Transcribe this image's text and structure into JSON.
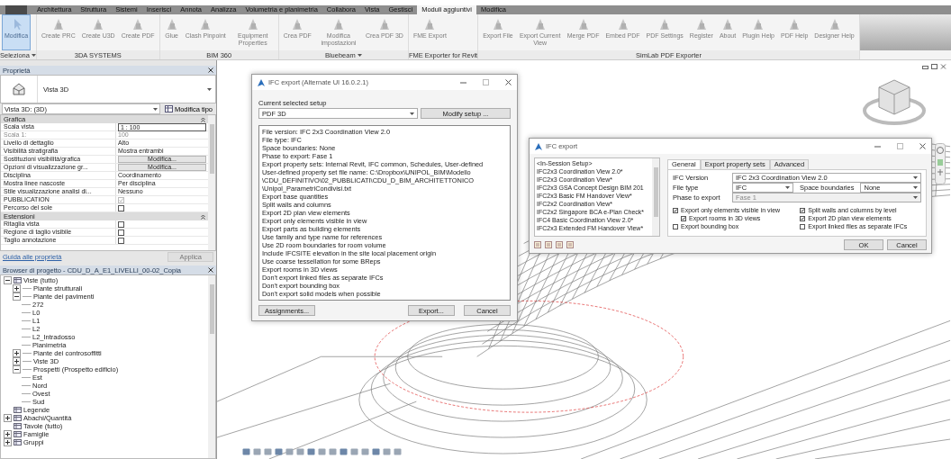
{
  "ribbon": {
    "tabs": [
      {
        "label": "Architettura",
        "selected": false
      },
      {
        "label": "Struttura",
        "selected": false
      },
      {
        "label": "Sistemi",
        "selected": false
      },
      {
        "label": "Inserisci",
        "selected": false
      },
      {
        "label": "Annota",
        "selected": false
      },
      {
        "label": "Analizza",
        "selected": false
      },
      {
        "label": "Volumetria e planimetria",
        "selected": false
      },
      {
        "label": "Collabora",
        "selected": false
      },
      {
        "label": "Vista",
        "selected": false
      },
      {
        "label": "Gestisci",
        "selected": false
      },
      {
        "label": "Moduli aggiuntivi",
        "selected": true
      },
      {
        "label": "Modifica",
        "selected": false
      }
    ],
    "panels": [
      {
        "title": "Seleziona",
        "dropdown": true,
        "buttons": [
          {
            "label": "Modifica",
            "selected": true
          }
        ]
      },
      {
        "title": "3DA SYSTEMS",
        "dropdown": false,
        "buttons": [
          {
            "label": "Create PRC",
            "selected": false
          },
          {
            "label": "Create U3D",
            "selected": false
          },
          {
            "label": "Create PDF",
            "selected": false
          }
        ]
      },
      {
        "title": "BIM 360",
        "dropdown": false,
        "buttons": [
          {
            "label": "Glue",
            "selected": false
          },
          {
            "label": "Clash Pinpoint",
            "selected": false
          },
          {
            "label": "Equipment Properties",
            "selected": false
          }
        ]
      },
      {
        "title": "Bluebeam",
        "dropdown": true,
        "buttons": [
          {
            "label": "Crea PDF",
            "selected": false
          },
          {
            "label": "Modifica impostazioni",
            "selected": false
          },
          {
            "label": "Crea PDF 3D",
            "selected": false
          }
        ]
      },
      {
        "title": "FME Exporter for Revit",
        "dropdown": false,
        "buttons": [
          {
            "label": "FME Export",
            "selected": false
          }
        ]
      },
      {
        "title": "SimLab PDF Exporter",
        "dropdown": false,
        "buttons": [
          {
            "label": "Export File",
            "selected": false
          },
          {
            "label": "Export Current View",
            "selected": false
          },
          {
            "label": "Merge PDF",
            "selected": false
          },
          {
            "label": "Embed PDF",
            "selected": false
          },
          {
            "label": "PDF Settings",
            "selected": false
          },
          {
            "label": "Register",
            "selected": false
          },
          {
            "label": "About",
            "selected": false
          },
          {
            "label": "Plugin Help",
            "selected": false
          },
          {
            "label": "PDF Help",
            "selected": false
          },
          {
            "label": "Designer Help",
            "selected": false
          }
        ]
      }
    ]
  },
  "properties": {
    "title": "Proprietà",
    "type_name": "Vista 3D",
    "instance": "Vista 3D: (3D)",
    "edit_type": "Modifica tipo",
    "groups": [
      {
        "name": "Grafica",
        "rows": [
          {
            "label": "Scala vista",
            "kind": "input",
            "value": "1 : 100",
            "disabled": false
          },
          {
            "label": "Scala 1:",
            "kind": "text",
            "value": "100",
            "disabled": true
          },
          {
            "label": "Livello di dettaglio",
            "kind": "text",
            "value": "Alto",
            "disabled": false
          },
          {
            "label": "Visibilità stratigrafia",
            "kind": "text",
            "value": "Mostra entrambi",
            "disabled": false
          },
          {
            "label": "Sostituzioni visibilità/grafica",
            "kind": "button",
            "value": "Modifica...",
            "disabled": false
          },
          {
            "label": "Opzioni di visualizzazione gr...",
            "kind": "button",
            "value": "Modifica...",
            "disabled": false
          },
          {
            "label": "Disciplina",
            "kind": "text",
            "value": "Coordinamento",
            "disabled": false
          },
          {
            "label": "Mostra linee nascoste",
            "kind": "text",
            "value": "Per disciplina",
            "disabled": false
          },
          {
            "label": "Stile visualizzazione analisi di...",
            "kind": "text",
            "value": "Nessuno",
            "disabled": false
          },
          {
            "label": "PUBBLICATION",
            "kind": "checkbox",
            "checked": true,
            "disabled": true
          },
          {
            "label": "Percorso del sole",
            "kind": "checkbox",
            "checked": false,
            "disabled": false
          }
        ]
      },
      {
        "name": "Estensioni",
        "rows": [
          {
            "label": "Ritaglia vista",
            "kind": "checkbox",
            "checked": false,
            "disabled": false
          },
          {
            "label": "Regione di taglio visibile",
            "kind": "checkbox",
            "checked": false,
            "disabled": false
          },
          {
            "label": "Taglio annotazione",
            "kind": "checkbox",
            "checked": false,
            "disabled": false
          }
        ]
      }
    ],
    "help_link": "Guida alle proprietà",
    "apply": "Applica"
  },
  "project_browser": {
    "title": "Browser di progetto - CDU_D_A_E1_LIVELLI_00-02_Copia",
    "tree": [
      {
        "label": "Viste (tutto)",
        "kind": "category",
        "expanded": true,
        "children": [
          {
            "label": "Piante strutturali",
            "kind": "folder",
            "expanded": false
          },
          {
            "label": "Piante dei pavimenti",
            "kind": "folder",
            "expanded": true,
            "children": [
              {
                "label": "272",
                "kind": "leaf"
              },
              {
                "label": "L0",
                "kind": "leaf"
              },
              {
                "label": "L1",
                "kind": "leaf"
              },
              {
                "label": "L2",
                "kind": "leaf"
              },
              {
                "label": "L2_Intradosso",
                "kind": "leaf"
              },
              {
                "label": "Planimetria",
                "kind": "leaf"
              }
            ]
          },
          {
            "label": "Piante dei controsoffitti",
            "kind": "folder",
            "expanded": false
          },
          {
            "label": "Viste 3D",
            "kind": "folder",
            "expanded": false
          },
          {
            "label": "Prospetti (Prospetto edificio)",
            "kind": "folder",
            "expanded": true,
            "children": [
              {
                "label": "Est",
                "kind": "leaf"
              },
              {
                "label": "Nord",
                "kind": "leaf"
              },
              {
                "label": "Ovest",
                "kind": "leaf"
              },
              {
                "label": "Sud",
                "kind": "leaf"
              }
            ]
          }
        ]
      },
      {
        "label": "Legende",
        "kind": "category"
      },
      {
        "label": "Abachi/Quantità",
        "kind": "category",
        "expanded": false
      },
      {
        "label": "Tavole (tutto)",
        "kind": "category"
      },
      {
        "label": "Famiglie",
        "kind": "category",
        "expanded": false
      },
      {
        "label": "Gruppi",
        "kind": "category",
        "expanded": false
      }
    ]
  },
  "setup_dialog": {
    "title": "IFC export (Alternate UI 16.0.2.1)",
    "setup_label": "Current selected setup",
    "setup": "PDF 3D",
    "modify_button": "Modify setup ...",
    "summary": [
      "File version: IFC 2x3 Coordination View 2.0",
      "File type: IFC",
      "Space boundaries: None",
      "Phase to export: Fase 1",
      "Export property sets: Internal Revit, IFC common, Schedules, User-defined",
      "User-defined property set file name: C:\\Dropbox\\UNIPOL_BIM\\Modello",
      "\\CDU_DEFINITIVO\\02_PUBBLICATI\\CDU_D_BIM_ARCHITETTONICO",
      "\\Unipol_ParametriCondivisi.txt",
      "Export base quantities",
      "Split walls and columns",
      "Export 2D plan view elements",
      "Export only elements visible in view",
      "Export parts as building elements",
      "Use family and type name for references",
      "Use 2D room boundaries for room volume",
      "Include IFCSITE elevation in the site local placement origin",
      "Use coarse tessellation for some BReps",
      "Export rooms in 3D views",
      "Don't export linked files as separate IFCs",
      "Don't export bounding box",
      "Don't export solid models when possible"
    ],
    "buttons": [
      "Assignments...",
      "Export...",
      "Cancel"
    ]
  },
  "export_dialog": {
    "title": "IFC export",
    "setups": [
      {
        "label": "<In-Session Setup>",
        "selected": false
      },
      {
        "label": "IFC2x3 Coordination View 2.0*",
        "selected": false
      },
      {
        "label": "IFC2x3 Coordination View*",
        "selected": false
      },
      {
        "label": "IFC2x3 GSA Concept Design BIM 201",
        "selected": false
      },
      {
        "label": "IFC2x3 Basic FM Handover View*",
        "selected": false
      },
      {
        "label": "IFC2x2 Coordination View*",
        "selected": false
      },
      {
        "label": "IFC2x2 Singapore BCA e-Plan Check*",
        "selected": false
      },
      {
        "label": "IFC4 Basic Coordination View 2.0*",
        "selected": false
      },
      {
        "label": "IFC2x3 Extended FM Handover View*",
        "selected": false
      }
    ],
    "tabs": [
      {
        "label": "General",
        "selected": true
      },
      {
        "label": "Export property sets",
        "selected": false
      },
      {
        "label": "Advanced",
        "selected": false
      }
    ],
    "fields": [
      {
        "label": "IFC Version",
        "value": "IFC 2x3 Coordination View 2.0",
        "disabled": false
      },
      {
        "label": "File type",
        "value": "IFC",
        "disabled": false,
        "extra_label": "Space boundaries",
        "extra_value": "None"
      },
      {
        "label": "Phase to export",
        "value": "Fase 1",
        "disabled": true
      }
    ],
    "options_left": [
      {
        "label": "Export only elements visible in view",
        "checked": true,
        "children": [
          {
            "label": "Export rooms in 3D views",
            "checked": true
          }
        ]
      },
      {
        "label": "Export bounding box",
        "checked": false
      }
    ],
    "options_right": [
      {
        "label": "Split walls and columns by level",
        "checked": true
      },
      {
        "label": "Export 2D plan view elements",
        "checked": true
      },
      {
        "label": "Export linked files as separate IFCs",
        "checked": false
      }
    ],
    "buttons": [
      "OK",
      "Cancel"
    ]
  }
}
